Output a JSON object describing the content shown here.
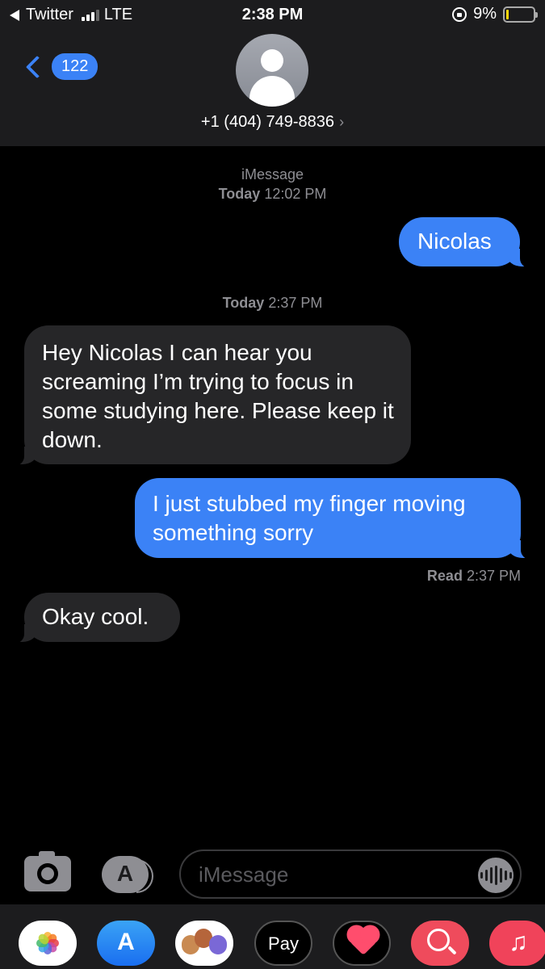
{
  "status_bar": {
    "back_app": "Twitter",
    "network": "LTE",
    "time": "2:38 PM",
    "battery_percent": "9%",
    "battery_level": 0.09,
    "signal_bars": 3
  },
  "header": {
    "back_count": "122",
    "contact": "+1 (404) 749-8836"
  },
  "conversation": {
    "service": "iMessage",
    "stamp1_day": "Today",
    "stamp1_time": "12:02 PM",
    "stamp2_day": "Today",
    "stamp2_time": "2:37 PM",
    "messages": [
      {
        "direction": "out",
        "text": "Nicolas"
      },
      {
        "direction": "in",
        "text": "Hey Nicolas I can hear you screaming I’m trying to focus in some studying here. Please keep it down."
      },
      {
        "direction": "out",
        "text": "I just stubbed my finger moving something sorry"
      },
      {
        "direction": "in",
        "text": "Okay cool."
      }
    ],
    "read_label": "Read",
    "read_time": "2:37 PM"
  },
  "composer": {
    "placeholder": "iMessage"
  },
  "app_drawer": {
    "icons": [
      "photos-icon",
      "app-store-icon",
      "memoji-icon",
      "apple-pay-icon",
      "heart-sticker-icon",
      "image-search-icon",
      "music-icon"
    ],
    "apple_pay_label": "Pay"
  },
  "colors": {
    "outgoing_bubble": "#3b82f6",
    "incoming_bubble": "#262628",
    "background": "#000000",
    "header": "#1c1c1e"
  }
}
